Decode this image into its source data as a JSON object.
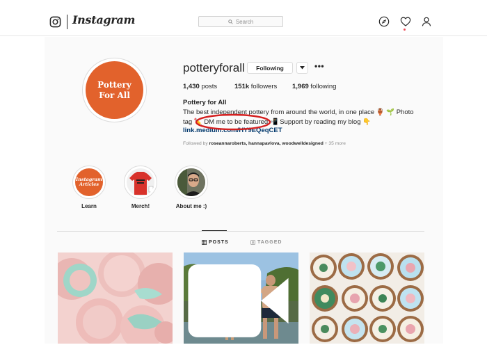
{
  "topbar": {
    "wordmark": "Instagram",
    "search_placeholder": "Search"
  },
  "profile": {
    "username": "potteryforall",
    "follow_label": "Following",
    "avatar_text_line1": "Pottery",
    "avatar_text_line2": "For All",
    "stats": {
      "posts_count": "1,430",
      "posts_label": "posts",
      "followers_count": "151k",
      "followers_label": "followers",
      "following_count": "1,969",
      "following_label": "following"
    },
    "full_name": "Pottery for All",
    "bio_line1": "The best independent pottery from around the world, in one place 🏺 🌱  Photo",
    "bio_line2": "tag ✏️ DM me to be featured 📲 Support by reading my blog 👇",
    "link": "link.medium.com/HY9EQeqCET",
    "followed_by_prefix": "Followed by",
    "followed_by_names": "roseannaroberts, hannapavlova, woodwelldesigned",
    "followed_by_more": "+ 35 more"
  },
  "highlights": [
    {
      "label": "Learn",
      "cover_text_1": "Instagram",
      "cover_text_2": "Articles"
    },
    {
      "label": "Merch!"
    },
    {
      "label": "About me :)"
    }
  ],
  "tabs": {
    "posts": "POSTS",
    "tagged": "TAGGED"
  },
  "colors": {
    "brand_orange": "#e2622c",
    "annotation_red": "#d42020",
    "link_blue": "#00376b"
  },
  "icons": {
    "logo": "instagram-glyph-icon",
    "explore": "compass-icon",
    "activity": "heart-icon",
    "profile": "person-icon",
    "video": "video-icon"
  }
}
